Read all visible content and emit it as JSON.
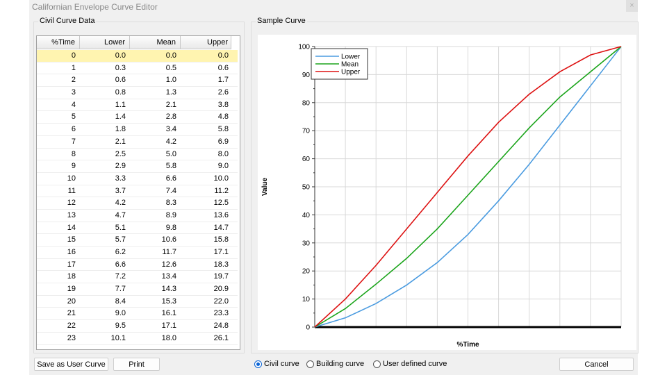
{
  "window": {
    "title": "Californian Envelope Curve Editor",
    "close_glyph": "×"
  },
  "left_group": {
    "label": "Civil Curve Data"
  },
  "right_group": {
    "label": "Sample Curve"
  },
  "table": {
    "columns": [
      "%Time",
      "Lower",
      "Mean",
      "Upper"
    ],
    "rows": [
      [
        "0",
        "0.0",
        "0.0",
        "0.0"
      ],
      [
        "1",
        "0.3",
        "0.5",
        "0.6"
      ],
      [
        "2",
        "0.6",
        "1.0",
        "1.7"
      ],
      [
        "3",
        "0.8",
        "1.3",
        "2.6"
      ],
      [
        "4",
        "1.1",
        "2.1",
        "3.8"
      ],
      [
        "5",
        "1.4",
        "2.8",
        "4.8"
      ],
      [
        "6",
        "1.8",
        "3.4",
        "5.8"
      ],
      [
        "7",
        "2.1",
        "4.2",
        "6.9"
      ],
      [
        "8",
        "2.5",
        "5.0",
        "8.0"
      ],
      [
        "9",
        "2.9",
        "5.8",
        "9.0"
      ],
      [
        "10",
        "3.3",
        "6.6",
        "10.0"
      ],
      [
        "11",
        "3.7",
        "7.4",
        "11.2"
      ],
      [
        "12",
        "4.2",
        "8.3",
        "12.5"
      ],
      [
        "13",
        "4.7",
        "8.9",
        "13.6"
      ],
      [
        "14",
        "5.1",
        "9.8",
        "14.7"
      ],
      [
        "15",
        "5.7",
        "10.6",
        "15.8"
      ],
      [
        "16",
        "6.2",
        "11.7",
        "17.1"
      ],
      [
        "17",
        "6.6",
        "12.6",
        "18.3"
      ],
      [
        "18",
        "7.2",
        "13.4",
        "19.7"
      ],
      [
        "19",
        "7.7",
        "14.3",
        "20.9"
      ],
      [
        "20",
        "8.4",
        "15.3",
        "22.0"
      ],
      [
        "21",
        "9.0",
        "16.1",
        "23.3"
      ],
      [
        "22",
        "9.5",
        "17.1",
        "24.8"
      ],
      [
        "23",
        "10.1",
        "18.0",
        "26.1"
      ]
    ],
    "selected_row": 0
  },
  "buttons": {
    "save_user_curve": "Save as User Curve",
    "print": "Print",
    "cancel": "Cancel"
  },
  "radios": [
    {
      "label": "Civil curve",
      "checked": true
    },
    {
      "label": "Building curve",
      "checked": false
    },
    {
      "label": "User defined curve",
      "checked": false
    }
  ],
  "chart_data": {
    "type": "line",
    "xlabel": "%Time",
    "ylabel": "Value",
    "xlim": [
      0,
      100
    ],
    "ylim": [
      0,
      100
    ],
    "yticks": [
      0,
      10,
      20,
      30,
      40,
      50,
      60,
      70,
      80,
      90,
      100
    ],
    "grid": true,
    "legend_position": "top-left",
    "x": [
      0,
      10,
      20,
      30,
      40,
      50,
      60,
      70,
      80,
      90,
      100
    ],
    "series": [
      {
        "name": "Lower",
        "color": "#4a9be0",
        "values": [
          0,
          3.3,
          8.4,
          15.0,
          23.0,
          33.0,
          45.0,
          58.0,
          72.0,
          86.0,
          100
        ]
      },
      {
        "name": "Mean",
        "color": "#1aa41a",
        "values": [
          0,
          6.6,
          15.3,
          24.5,
          35.0,
          47.0,
          59.0,
          71.0,
          82.0,
          91.0,
          100
        ]
      },
      {
        "name": "Upper",
        "color": "#dd1111",
        "values": [
          0,
          10.0,
          22.0,
          35.0,
          48.0,
          61.0,
          73.0,
          83.0,
          91.0,
          97.0,
          100
        ]
      }
    ]
  }
}
